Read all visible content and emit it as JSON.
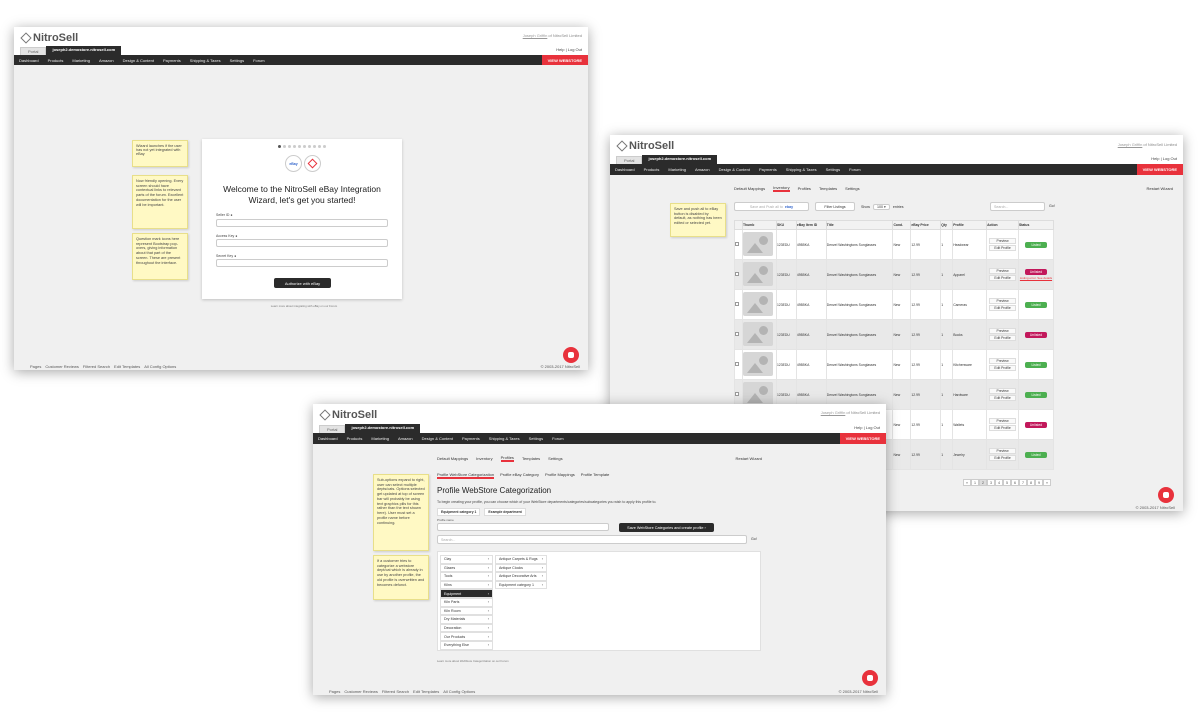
{
  "common": {
    "brand": "NitroSell",
    "user": "Joseph Griffin",
    "user_suffix": " of NitroSell Limited",
    "tab_portal": "Portal",
    "tab_store": "joseph2.demostore.nitrosell.com",
    "help": "Help",
    "logout": "Log Out",
    "nav": [
      "Dashboard",
      "Products",
      "Marketing",
      "Amazon",
      "Design & Content",
      "Payments",
      "Shipping & Taxes",
      "Settings",
      "Forum"
    ],
    "view_webstore": "VIEW WEBSTORE",
    "footer_links": [
      "Pages",
      "Customer Reviews",
      "Filtered Search",
      "Edit Templates",
      "All Config Options"
    ],
    "copyright": "© 2003-2017 NitroSell"
  },
  "wizard": {
    "notes": [
      "Wizard launches if the user has not yet integrated with eBay",
      "Now friendly opening. Every screen should have contextual links to relevant parts of the forum. Excellent documentation for the user will be important.",
      "Question mark icons here represent Bootstrap pop-overs, giving information about that part of the screen. These are present throughout the interface."
    ],
    "logo_left": "eBay",
    "title": "Welcome to the NitroSell eBay Integration Wizard, let's get you started!",
    "fields": [
      {
        "label": "Seller ID",
        "value": ""
      },
      {
        "label": "Access Key",
        "value": ""
      },
      {
        "label": "Secret Key",
        "value": ""
      }
    ],
    "button": "Authorize with eBay",
    "foot_link": "Learn more about integrating with eBay on our Forum"
  },
  "inventory": {
    "note": "Save and push all to eBay button is disabled by default, as nothing has been edited or selected yet.",
    "tabs": [
      "Default Mappings",
      "Inventory",
      "Profiles",
      "Templates",
      "Settings"
    ],
    "restart": "Restart Wizard",
    "save_btn": "Save and Push all to",
    "save_btn_brand": "ebay",
    "filter": "Filter Listings",
    "show": "Show",
    "show_value": "100",
    "entries": "entries",
    "search_placeholder": "Search...",
    "go": "Go!",
    "columns": [
      "Thumb",
      "SKU",
      "eBay Item ID",
      "Title",
      "Cond.",
      "eBay Price",
      "Qty",
      "Profile",
      "Action",
      "Status"
    ],
    "action_preview": "Preview",
    "action_edit": "Edit Profile",
    "rows": [
      {
        "sku": "123EDU",
        "item": "49B5KA",
        "title": "Denzel Washingtons Sunglasses",
        "cond": "New",
        "price": "12.99",
        "qty": "1",
        "profile": "Headwear",
        "status": "Listed",
        "err": ""
      },
      {
        "sku": "123EDU",
        "item": "49B5KA",
        "title": "Denzel Washingtons Sunglasses",
        "cond": "New",
        "price": "12.99",
        "qty": "1",
        "profile": "Apparel",
        "status": "Unlisted",
        "err": "Listing error. See details"
      },
      {
        "sku": "123EDU",
        "item": "49B5KA",
        "title": "Denzel Washingtons Sunglasses",
        "cond": "New",
        "price": "12.99",
        "qty": "1",
        "profile": "Cameras",
        "status": "Listed",
        "err": ""
      },
      {
        "sku": "123EDU",
        "item": "49B5KA",
        "title": "Denzel Washingtons Sunglasses",
        "cond": "New",
        "price": "12.99",
        "qty": "1",
        "profile": "Books",
        "status": "Unlisted",
        "err": ""
      },
      {
        "sku": "123EDU",
        "item": "49B5KA",
        "title": "Denzel Washingtons Sunglasses",
        "cond": "New",
        "price": "12.99",
        "qty": "1",
        "profile": "Kitchenware",
        "status": "Listed",
        "err": ""
      },
      {
        "sku": "123EDU",
        "item": "49B5KA",
        "title": "Denzel Washingtons Sunglasses",
        "cond": "New",
        "price": "12.99",
        "qty": "1",
        "profile": "Hardware",
        "status": "Listed",
        "err": ""
      },
      {
        "sku": "123EDU",
        "item": "49B5KA",
        "title": "Denzel Washingtons Sunglasses",
        "cond": "New",
        "price": "12.99",
        "qty": "1",
        "profile": "Wallets",
        "status": "Unlisted",
        "err": ""
      },
      {
        "sku": "123EDU",
        "item": "49B5KA",
        "title": "Denzel Washingtons Sunglasses",
        "cond": "New",
        "price": "12.99",
        "qty": "1",
        "profile": "Jewelry",
        "status": "Listed",
        "err": ""
      }
    ],
    "pages": [
      "«",
      "1",
      "2",
      "3",
      "4",
      "5",
      "6",
      "7",
      "8",
      "9",
      "»"
    ],
    "current_page": "2"
  },
  "profiles": {
    "notes": [
      "Sub-options expand to right, user can select multiple depts/cats. Options selected get updated at top of screen bar will probably be using text graphics pills for this rather than the text shown here). User must set a profile name before continuing.",
      "If a customer tries to categorize a webstore dept/cat which is already in use by another profile, the old profile is overwritten and becomes defunct."
    ],
    "tabs": [
      "Default Mappings",
      "Inventory",
      "Profiles",
      "Templates",
      "Settings"
    ],
    "restart": "Restart Wizard",
    "subtabs": [
      "Profile WebStore Categorization",
      "Profile eBay Category",
      "Profile Mappings",
      "Profile Template"
    ],
    "title": "Profile WebStore Categorization",
    "intro": "To begin creating your profile, you can choose which of your WebStore departments/categories/subcategories you wish to apply this profile to.",
    "pills": [
      "Equipment category 1",
      "Example department"
    ],
    "profile_name_label": "Profile name",
    "save_btn": "Save WebStore Categories and create profile",
    "search_placeholder": "Search...",
    "go": "Go!",
    "col1": [
      "Clay",
      "Glazes",
      "Tools",
      "Kilns",
      "Equipment",
      "Kiln Parts",
      "Kiln Room",
      "Dry Materials",
      "Decoration",
      "Our Products",
      "Everything Else"
    ],
    "col1_selected": "Equipment",
    "col2": [
      "Antique Carpets & Rugs",
      "Antique Clocks",
      "Antique Decorative Arts",
      "Equipment category 1"
    ],
    "foot_link": "Learn more about WebStore Categorization on our Forum"
  }
}
